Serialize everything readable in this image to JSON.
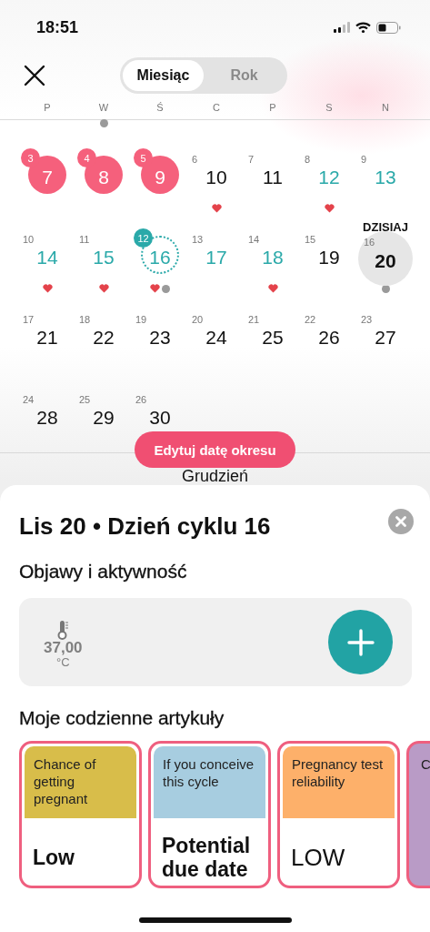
{
  "status_bar": {
    "time": "18:51"
  },
  "header": {
    "segments": [
      {
        "label": "Miesiąc",
        "selected": true
      },
      {
        "label": "Rok",
        "selected": false
      }
    ]
  },
  "weekdays": [
    {
      "label": "P",
      "dot": false
    },
    {
      "label": "W",
      "dot": true
    },
    {
      "label": "Ś",
      "dot": false
    },
    {
      "label": "C",
      "dot": false
    },
    {
      "label": "P",
      "dot": false
    },
    {
      "label": "S",
      "dot": false
    },
    {
      "label": "N",
      "dot": false
    }
  ],
  "days": [
    {
      "cycle_day": "3",
      "date": "7",
      "kind": "period",
      "heart": false,
      "dot": false
    },
    {
      "cycle_day": "4",
      "date": "8",
      "kind": "period",
      "heart": false,
      "dot": false
    },
    {
      "cycle_day": "5",
      "date": "9",
      "kind": "period",
      "heart": false,
      "dot": false
    },
    {
      "cycle_day": "6",
      "date": "10",
      "kind": "plain",
      "heart": true,
      "dot": false
    },
    {
      "cycle_day": "7",
      "date": "11",
      "kind": "plain",
      "heart": false,
      "dot": false
    },
    {
      "cycle_day": "8",
      "date": "12",
      "kind": "fertile",
      "heart": true,
      "dot": false
    },
    {
      "cycle_day": "9",
      "date": "13",
      "kind": "fertile",
      "heart": false,
      "dot": false
    },
    {
      "cycle_day": "10",
      "date": "14",
      "kind": "fertile",
      "heart": true,
      "dot": false
    },
    {
      "cycle_day": "11",
      "date": "15",
      "kind": "fertile",
      "heart": true,
      "dot": false
    },
    {
      "cycle_day": "12",
      "date": "16",
      "kind": "ovulation",
      "heart": true,
      "dot": true
    },
    {
      "cycle_day": "13",
      "date": "17",
      "kind": "fertile",
      "heart": false,
      "dot": false
    },
    {
      "cycle_day": "14",
      "date": "18",
      "kind": "fertile",
      "heart": true,
      "dot": false
    },
    {
      "cycle_day": "15",
      "date": "19",
      "kind": "plain",
      "heart": false,
      "dot": false
    },
    {
      "cycle_day": "16",
      "date": "20",
      "kind": "today",
      "label": "DZISIAJ",
      "heart": false,
      "dot": true
    },
    {
      "cycle_day": "17",
      "date": "21",
      "kind": "plain",
      "heart": false,
      "dot": false
    },
    {
      "cycle_day": "18",
      "date": "22",
      "kind": "plain",
      "heart": false,
      "dot": false
    },
    {
      "cycle_day": "19",
      "date": "23",
      "kind": "plain",
      "heart": false,
      "dot": false
    },
    {
      "cycle_day": "20",
      "date": "24",
      "kind": "plain",
      "heart": false,
      "dot": false
    },
    {
      "cycle_day": "21",
      "date": "25",
      "kind": "plain",
      "heart": false,
      "dot": false
    },
    {
      "cycle_day": "22",
      "date": "26",
      "kind": "plain",
      "heart": false,
      "dot": false
    },
    {
      "cycle_day": "23",
      "date": "27",
      "kind": "plain",
      "heart": false,
      "dot": false
    },
    {
      "cycle_day": "24",
      "date": "28",
      "kind": "plain",
      "heart": false,
      "dot": false
    },
    {
      "cycle_day": "25",
      "date": "29",
      "kind": "plain",
      "heart": false,
      "dot": false
    },
    {
      "cycle_day": "26",
      "date": "30",
      "kind": "plain",
      "heart": false,
      "dot": false
    }
  ],
  "edit_button": "Edytuj datę okresu",
  "next_month": "Grudzień",
  "sheet": {
    "title": "Lis 20 • Dzień cyklu 16",
    "section": "Objawy i aktywność",
    "temperature": {
      "value": "37,00",
      "unit": "°C"
    },
    "articles_title": "Moje codzienne artykuły",
    "articles": [
      {
        "heading": "Chance of getting pregnant",
        "value": "Low",
        "color": "#d8bd4a",
        "kind": "bold"
      },
      {
        "heading": "If you conceive this cycle",
        "value": "Potential due date",
        "color": "#a7cde0",
        "kind": "bold"
      },
      {
        "heading": "Pregnancy test reliability",
        "value": "LOW",
        "color": "#fdb06a",
        "kind": "regular"
      },
      {
        "heading": "C",
        "color": "#b99bc6",
        "kind": "cut"
      }
    ]
  }
}
